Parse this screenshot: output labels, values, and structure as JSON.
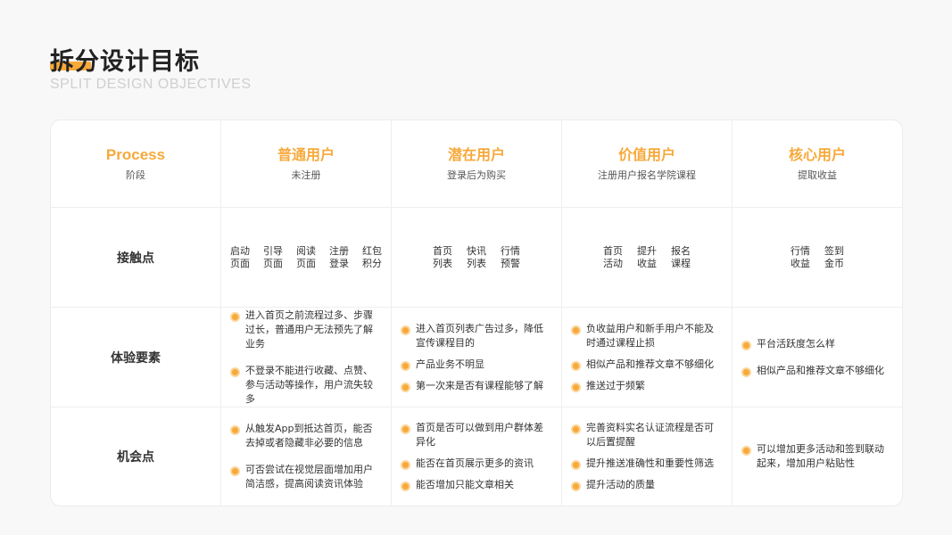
{
  "page": {
    "title": "拆分设计目标",
    "subtitle": "SPLIT DESIGN OBJECTIVES",
    "accent_color": "#f7a93a"
  },
  "columns": [
    {
      "title": "Process",
      "sub": "阶段"
    },
    {
      "title": "普通用户",
      "sub": "未注册"
    },
    {
      "title": "潜在用户",
      "sub": "登录后为购买"
    },
    {
      "title": "价值用户",
      "sub": "注册用户报名学院课程"
    },
    {
      "title": "核心用户",
      "sub": "提取收益"
    }
  ],
  "rows": {
    "touchpoints": {
      "label": "接触点",
      "cells": [
        [
          "启动页面",
          "引导页面",
          "阅读页面",
          "注册登录",
          "红包积分"
        ],
        [
          "首页列表",
          "快讯列表",
          "行情预警"
        ],
        [
          "首页活动",
          "提升收益",
          "报名课程"
        ],
        [
          "行情收益",
          "签到金币"
        ]
      ]
    },
    "experience": {
      "label": "体验要素",
      "cells": [
        [
          "进入首页之前流程过多、步骤过长，普通用户无法预先了解业务",
          "不登录不能进行收藏、点赞、参与活动等操作，用户流失较多"
        ],
        [
          "进入首页列表广告过多，降低宣传课程目的",
          "产品业务不明显",
          "第一次来是否有课程能够了解"
        ],
        [
          "负收益用户和新手用户不能及时通过课程止损",
          "相似产品和推荐文章不够细化",
          "推送过于频繁"
        ],
        [
          "平台活跃度怎么样",
          "相似产品和推荐文章不够细化"
        ]
      ]
    },
    "opportunity": {
      "label": "机会点",
      "cells": [
        [
          "从触发App到抵达首页，能否去掉或者隐藏非必要的信息",
          "可否尝试在视觉层面增加用户简洁感，提高阅读资讯体验"
        ],
        [
          "首页是否可以做到用户群体差异化",
          "能否在首页展示更多的资讯",
          "能否增加只能文章相关"
        ],
        [
          "完善资料实名认证流程是否可以后置提醒",
          "提升推送准确性和重要性筛选",
          "提升活动的质量"
        ],
        [
          "可以增加更多活动和签到联动起来，增加用户粘贴性"
        ]
      ]
    }
  }
}
